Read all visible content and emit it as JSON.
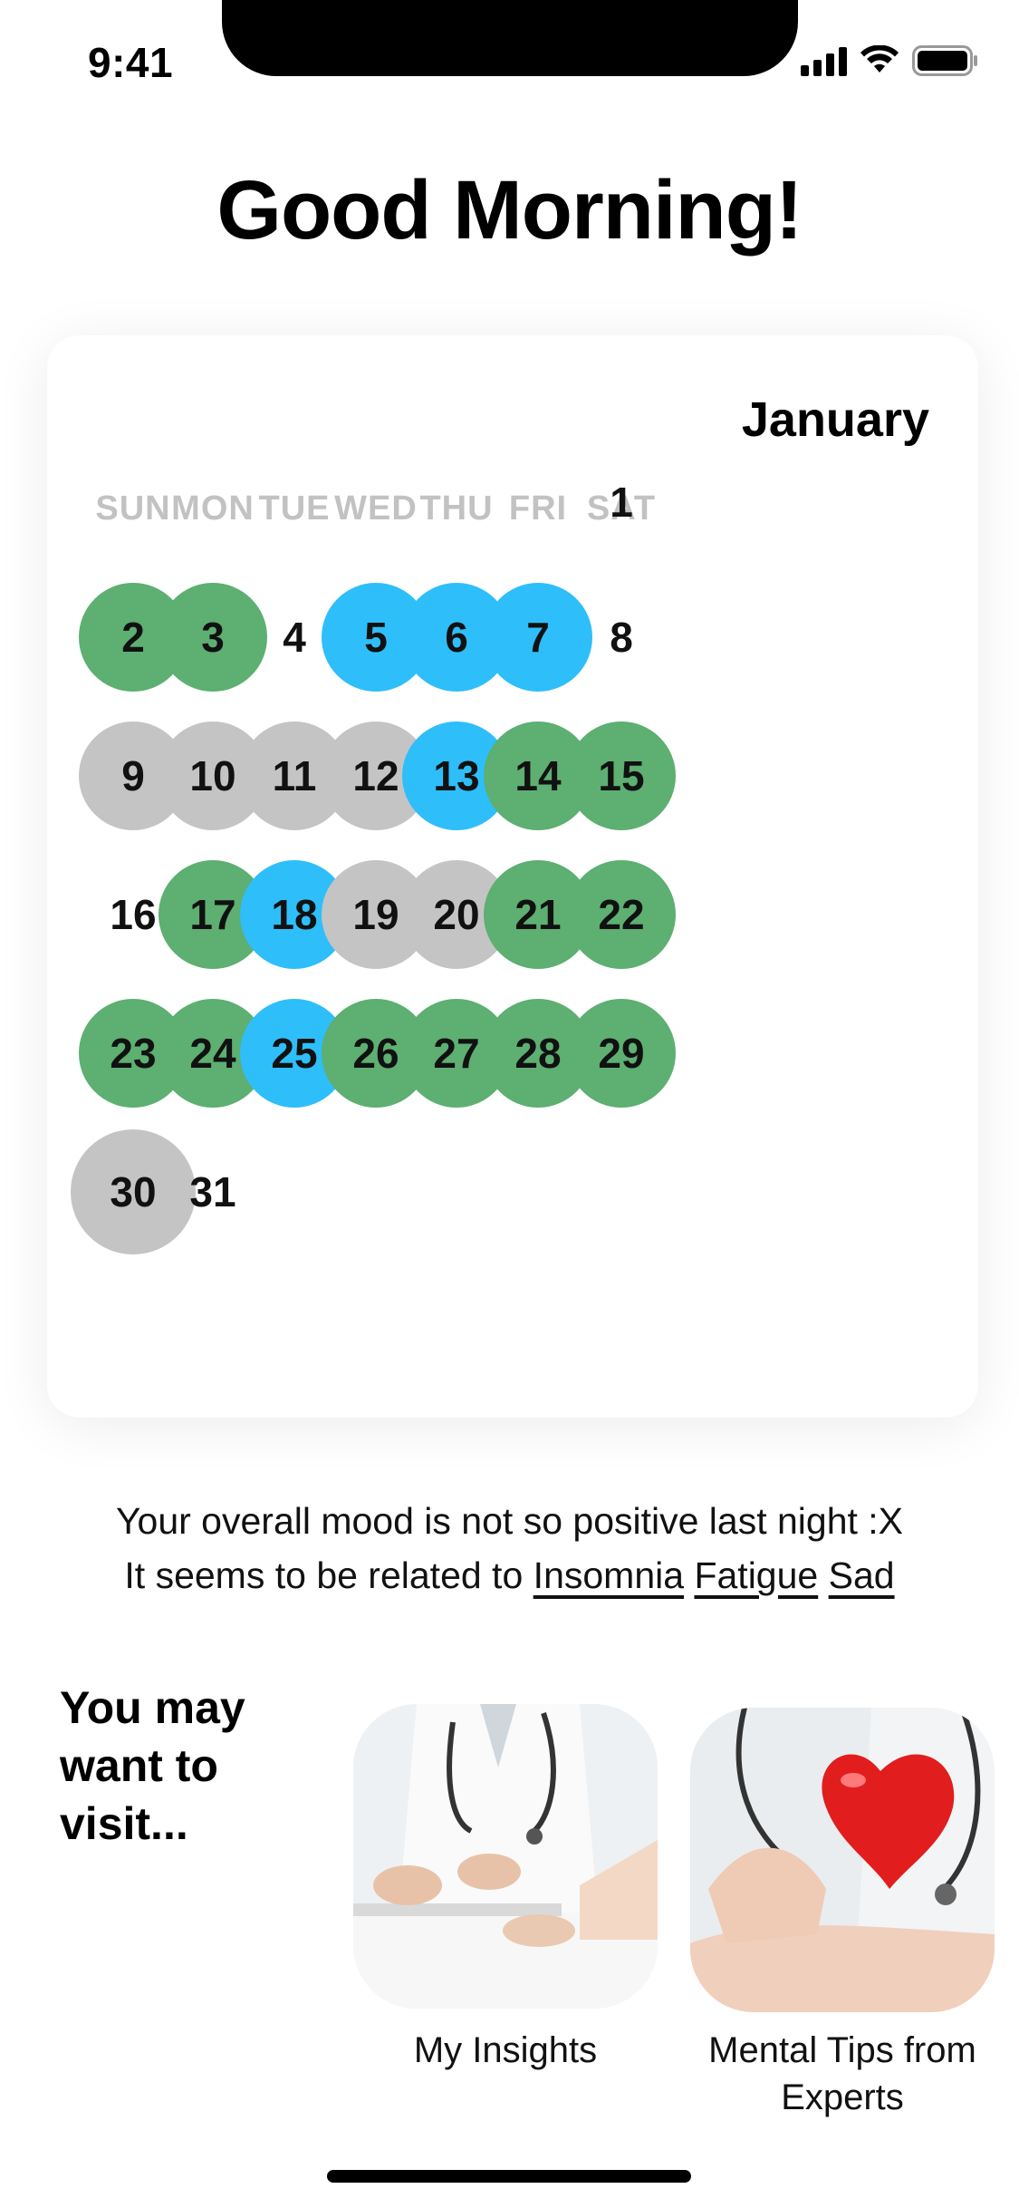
{
  "status_bar": {
    "time": "9:41"
  },
  "greeting": "Good Morning!",
  "calendar": {
    "month": "January",
    "weekdays": [
      "SUN",
      "MON",
      "TUE",
      "WED",
      "THU",
      "FRI",
      "SAT"
    ],
    "days": [
      {
        "d": "1",
        "mood": "none"
      },
      {
        "d": "2",
        "mood": "green"
      },
      {
        "d": "3",
        "mood": "green"
      },
      {
        "d": "4",
        "mood": "none"
      },
      {
        "d": "5",
        "mood": "blue"
      },
      {
        "d": "6",
        "mood": "blue"
      },
      {
        "d": "7",
        "mood": "blue"
      },
      {
        "d": "8",
        "mood": "none"
      },
      {
        "d": "9",
        "mood": "gray"
      },
      {
        "d": "10",
        "mood": "gray"
      },
      {
        "d": "11",
        "mood": "gray"
      },
      {
        "d": "12",
        "mood": "gray"
      },
      {
        "d": "13",
        "mood": "blue"
      },
      {
        "d": "14",
        "mood": "green"
      },
      {
        "d": "15",
        "mood": "green"
      },
      {
        "d": "16",
        "mood": "none"
      },
      {
        "d": "17",
        "mood": "green"
      },
      {
        "d": "18",
        "mood": "blue"
      },
      {
        "d": "19",
        "mood": "gray"
      },
      {
        "d": "20",
        "mood": "gray"
      },
      {
        "d": "21",
        "mood": "green"
      },
      {
        "d": "22",
        "mood": "green"
      },
      {
        "d": "23",
        "mood": "green"
      },
      {
        "d": "24",
        "mood": "green"
      },
      {
        "d": "25",
        "mood": "blue"
      },
      {
        "d": "26",
        "mood": "green"
      },
      {
        "d": "27",
        "mood": "green"
      },
      {
        "d": "28",
        "mood": "green"
      },
      {
        "d": "29",
        "mood": "green"
      },
      {
        "d": "30",
        "mood": "gray"
      },
      {
        "d": "31",
        "mood": "none"
      }
    ],
    "colors": {
      "green": "#5daf72",
      "blue": "#2ebefa",
      "gray": "#c4c4c4"
    }
  },
  "mood_summary": {
    "line1": "Your overall mood is not so positive last night :X",
    "line2_prefix": "It seems to be related to",
    "tags": [
      "Insomnia",
      "Fatigue",
      "Sad"
    ]
  },
  "visit": {
    "heading": "You may want to visit...",
    "cards": [
      {
        "label": "My Insights",
        "image": "doctor-consultation-image"
      },
      {
        "label": "Mental Tips from Experts",
        "image": "heart-in-hands-image"
      }
    ]
  }
}
